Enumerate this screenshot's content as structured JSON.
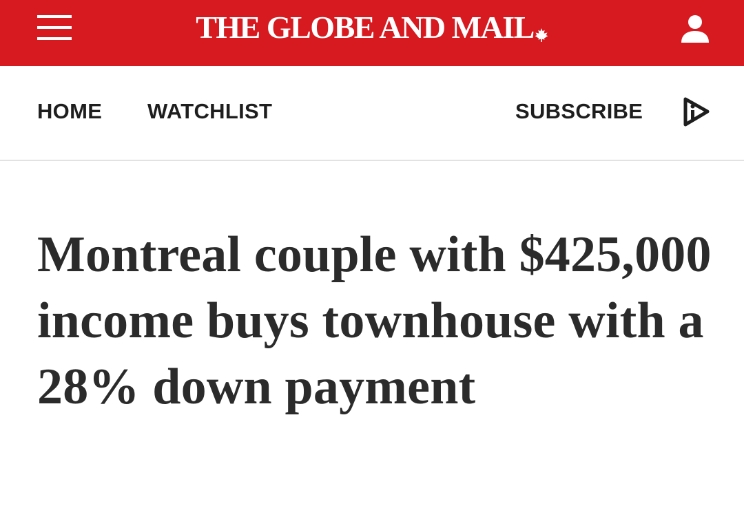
{
  "header": {
    "brand": "THE GLOBE AND MAIL",
    "brand_color": "#d71920",
    "menu_icon": "hamburger-menu-icon",
    "account_icon": "user-account-icon",
    "brand_icon": "maple-leaf-icon"
  },
  "nav": {
    "links": [
      {
        "label": "HOME"
      },
      {
        "label": "WATCHLIST"
      }
    ],
    "subscribe_label": "SUBSCRIBE",
    "video_icon": "play-video-icon"
  },
  "article": {
    "headline": "Montreal couple with $425,000 income buys townhouse with a 28% down payment"
  }
}
